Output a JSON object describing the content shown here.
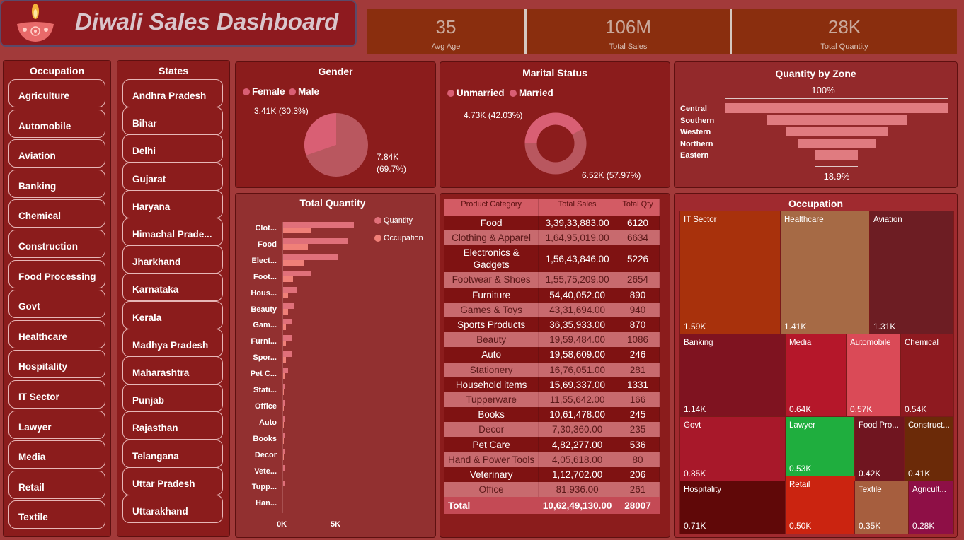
{
  "title": "Diwali Sales Dashboard",
  "kpis": [
    {
      "value": "35",
      "label": "Avg Age"
    },
    {
      "value": "106M",
      "label": "Total Sales"
    },
    {
      "value": "28K",
      "label": "Total Quantity"
    }
  ],
  "occupation_slicer": {
    "title": "Occupation",
    "items": [
      "Agriculture",
      "Automobile",
      "Aviation",
      "Banking",
      "Chemical",
      "Construction",
      "Food Processing",
      "Govt",
      "Healthcare",
      "Hospitality",
      "IT Sector",
      "Lawyer",
      "Media",
      "Retail",
      "Textile"
    ]
  },
  "states_slicer": {
    "title": "States",
    "items": [
      "Andhra Pradesh",
      "Bihar",
      "Delhi",
      "Gujarat",
      "Haryana",
      "Himachal Prade...",
      "Jharkhand",
      "Karnataka",
      "Kerala",
      "Madhya Pradesh",
      "Maharashtra",
      "Punjab",
      "Rajasthan",
      "Telangana",
      "Uttar Pradesh",
      "Uttarakhand"
    ]
  },
  "gender": {
    "title": "Gender",
    "legend": [
      "Female",
      "Male"
    ],
    "female_label": "3.41K (30.3%)",
    "male_label_1": "7.84K",
    "male_label_2": "(69.7%)",
    "female_share": 30.3,
    "colors": {
      "female": "#d95f74",
      "male": "#b9575f"
    }
  },
  "marital": {
    "title": "Marital Status",
    "legend": [
      "Unmarried",
      "Married"
    ],
    "married_label": "4.73K (42.03%)",
    "unmarried_label": "6.52K (57.97%)",
    "married_share": 42.03,
    "colors": {
      "unmarried": "#b9575f",
      "married": "#d95f74"
    }
  },
  "zone": {
    "title": "Quantity by Zone",
    "top_pct": "100%",
    "bottom_pct": "18.9%",
    "zones": [
      "Central",
      "Southern",
      "Western",
      "Northern",
      "Eastern"
    ],
    "relative": [
      100,
      63,
      46,
      35,
      19
    ]
  },
  "total_quantity": {
    "title": "Total Quantity",
    "legend": [
      "Quantity",
      "Occupation"
    ],
    "axis": [
      "0K",
      "5K"
    ],
    "colors": {
      "quantity": "#e0707a",
      "occupation": "#f08078"
    }
  },
  "product_table": {
    "headers": [
      "Product Category",
      "Total Sales",
      "Total Qty"
    ],
    "rows": [
      [
        "Food",
        "3,39,33,883.00",
        "6120"
      ],
      [
        "Clothing & Apparel",
        "1,64,95,019.00",
        "6634"
      ],
      [
        "Electronics & Gadgets",
        "1,56,43,846.00",
        "5226"
      ],
      [
        "Footwear & Shoes",
        "1,55,75,209.00",
        "2654"
      ],
      [
        "Furniture",
        "54,40,052.00",
        "890"
      ],
      [
        "Games & Toys",
        "43,31,694.00",
        "940"
      ],
      [
        "Sports Products",
        "36,35,933.00",
        "870"
      ],
      [
        "Beauty",
        "19,59,484.00",
        "1086"
      ],
      [
        "Auto",
        "19,58,609.00",
        "246"
      ],
      [
        "Stationery",
        "16,76,051.00",
        "281"
      ],
      [
        "Household items",
        "15,69,337.00",
        "1331"
      ],
      [
        "Tupperware",
        "11,55,642.00",
        "166"
      ],
      [
        "Books",
        "10,61,478.00",
        "245"
      ],
      [
        "Decor",
        "7,30,360.00",
        "235"
      ],
      [
        "Pet Care",
        "4,82,277.00",
        "536"
      ],
      [
        "Hand & Power Tools",
        "4,05,618.00",
        "80"
      ],
      [
        "Veterinary",
        "1,12,702.00",
        "206"
      ],
      [
        "Office",
        "81,936.00",
        "261"
      ]
    ],
    "total": [
      "Total",
      "10,62,49,130.00",
      "28007"
    ]
  },
  "occupation_treemap": {
    "title": "Occupation",
    "items": [
      {
        "name": "IT Sector",
        "value": "1.59K",
        "color": "#a8310c"
      },
      {
        "name": "Healthcare",
        "value": "1.41K",
        "color": "#a66a45"
      },
      {
        "name": "Aviation",
        "value": "1.31K",
        "color": "#6d1d23"
      },
      {
        "name": "Banking",
        "value": "1.14K",
        "color": "#7f1320"
      },
      {
        "name": "Media",
        "value": "0.64K",
        "color": "#b5172a"
      },
      {
        "name": "Automobile",
        "value": "0.57K",
        "color": "#da4a57"
      },
      {
        "name": "Chemical",
        "value": "0.54K",
        "color": "#8e1a20"
      },
      {
        "name": "Govt",
        "value": "0.85K",
        "color": "#a8182a"
      },
      {
        "name": "Lawyer",
        "value": "0.53K",
        "color": "#1fae3e"
      },
      {
        "name": "Food Pro...",
        "value": "0.42K",
        "color": "#701520"
      },
      {
        "name": "Construct...",
        "value": "0.41K",
        "color": "#6b2a08"
      },
      {
        "name": "Hospitality",
        "value": "0.71K",
        "color": "#600808"
      },
      {
        "name": "Retail",
        "value": "0.50K",
        "color": "#cb2410"
      },
      {
        "name": "Textile",
        "value": "0.35K",
        "color": "#a65e3e"
      },
      {
        "name": "Agricult...",
        "value": "0.28K",
        "color": "#8e0f46"
      }
    ]
  },
  "chart_data": [
    {
      "type": "bar",
      "title": "Total Quantity",
      "categories": [
        "Clot...",
        "Food",
        "Elect...",
        "Foot...",
        "Hous...",
        "Beauty",
        "Gam...",
        "Furni...",
        "Spor...",
        "Pet C...",
        "Stati...",
        "Office",
        "Auto",
        "Books",
        "Decor",
        "Vete...",
        "Tupp...",
        "Han..."
      ],
      "series": [
        {
          "name": "Quantity",
          "values": [
            6634,
            6120,
            5226,
            2654,
            1331,
            1086,
            940,
            890,
            870,
            536,
            281,
            261,
            246,
            245,
            235,
            206,
            166,
            80
          ]
        },
        {
          "name": "Occupation",
          "values": [
            2600,
            2400,
            2000,
            1000,
            500,
            500,
            350,
            350,
            350,
            200,
            120,
            110,
            100,
            100,
            100,
            90,
            70,
            40
          ]
        }
      ],
      "xlim": [
        0,
        8000
      ]
    },
    {
      "type": "pie",
      "title": "Gender",
      "categories": [
        "Female",
        "Male"
      ],
      "values": [
        3410,
        7840
      ]
    },
    {
      "type": "pie",
      "title": "Marital Status",
      "categories": [
        "Unmarried",
        "Married"
      ],
      "values": [
        6520,
        4730
      ]
    }
  ]
}
